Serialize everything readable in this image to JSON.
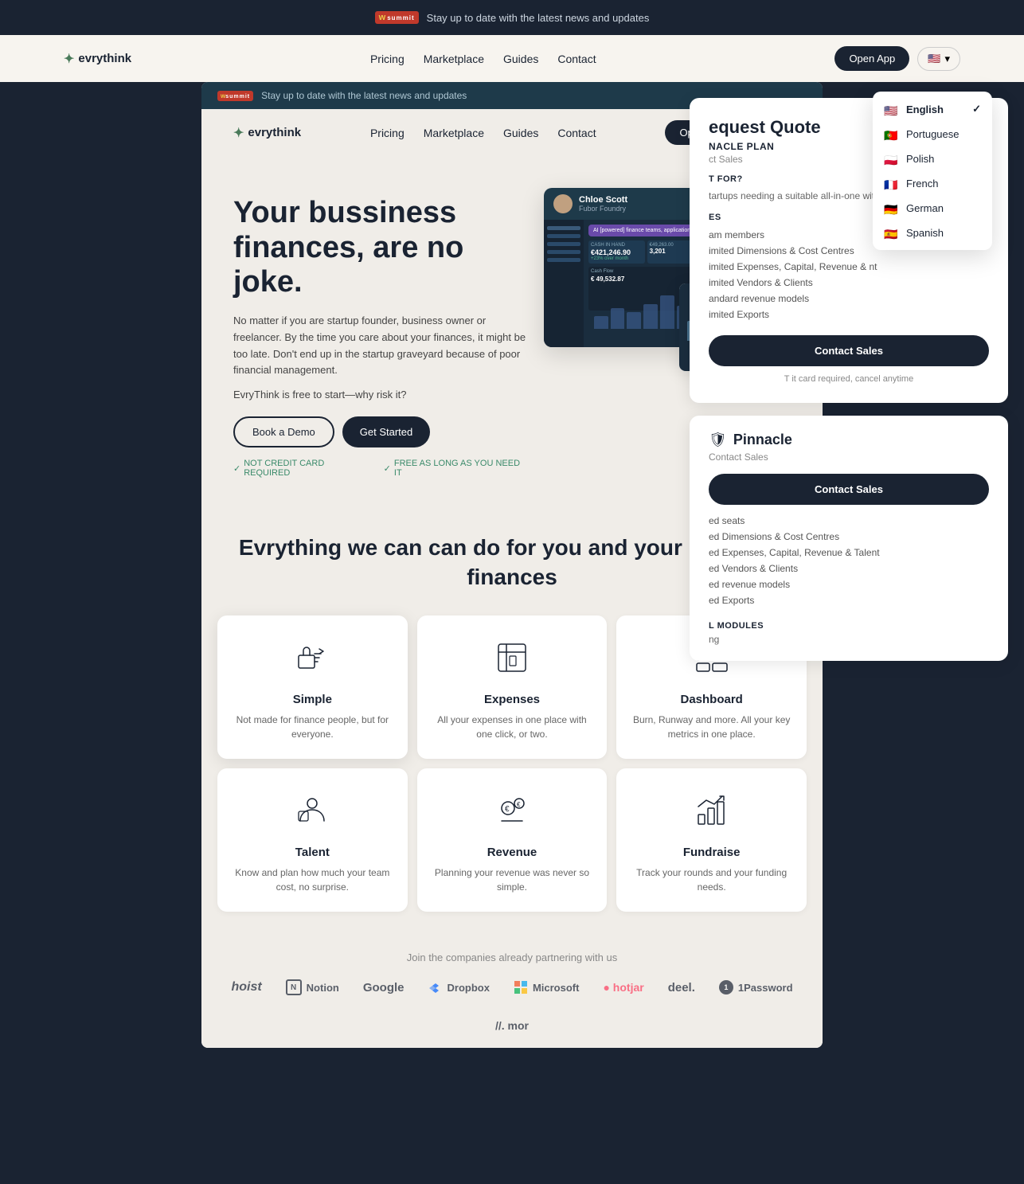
{
  "topBanner": {
    "text": "Stay up to date with the latest news and updates"
  },
  "nav": {
    "logo": "evrythink",
    "links": [
      "Pricing",
      "Marketplace",
      "Guides",
      "Contact"
    ],
    "openAppLabel": "Open App",
    "langCode": "🇺🇸"
  },
  "innerBanner": {
    "text": "Stay up to date with the latest news and updates"
  },
  "innerNav": {
    "logo": "evrythink",
    "links": [
      "Pricing",
      "Marketplace",
      "Guides",
      "Contact"
    ],
    "openAppLabel": "Open App"
  },
  "hero": {
    "title": "Your bussiness finances, are no joke.",
    "description": "No matter if you are startup founder, business owner or freelancer. By the time you care about your finances, it might be too late. Don't end up in the startup graveyard because of poor financial management.",
    "tagline": "EvryThink is free to start—why risk it?",
    "bookDemoLabel": "Book a Demo",
    "getStartedLabel": "Get Started",
    "note1": "NOT CREDIT CARD REQUIRED",
    "note2": "FREE AS LONG AS YOU NEED IT",
    "userAvatar": "Chloe Scott",
    "userRole": "Fubor Foundry",
    "cashLabel": "CASH IN HAND",
    "amount": "€421,246.90",
    "change": "+23% over month"
  },
  "sectionTitle": "Evrything we can can do for you and your business finances",
  "features": [
    {
      "name": "Simple",
      "desc": "Not made for finance people, but for everyone.",
      "icon": "👍"
    },
    {
      "name": "Expenses",
      "desc": "All your expenses in one place with one click, or two.",
      "icon": "📊"
    },
    {
      "name": "Dashboard",
      "desc": "Burn, Runway and more. All your key metrics in one place.",
      "icon": "📈"
    },
    {
      "name": "Talent",
      "desc": "Know and plan how much your team cost, no surprise.",
      "icon": "👥"
    },
    {
      "name": "Revenue",
      "desc": "Planning your revenue was never so simple.",
      "icon": "💰"
    },
    {
      "name": "Fundraise",
      "desc": "Track your rounds and your funding needs.",
      "icon": "🚀"
    }
  ],
  "partnersTitle": "Join the companies already partnering with us",
  "partners": [
    {
      "name": "hoist",
      "icon": "H"
    },
    {
      "name": "Notion",
      "icon": "N"
    },
    {
      "name": "Google",
      "icon": "G"
    },
    {
      "name": "Dropbox",
      "icon": "D"
    },
    {
      "name": "Microsoft",
      "icon": "M"
    },
    {
      "name": "hotjar",
      "icon": "h"
    },
    {
      "name": "deel.",
      "icon": "d"
    },
    {
      "name": "1Password",
      "icon": "1"
    },
    {
      "name": "mor",
      "icon": "m"
    }
  ],
  "rightPanel": {
    "quoteTitle": "equest Quote",
    "planLabel": "NACLE PLAN",
    "planSubLabel": "ct Sales",
    "forLabel": "T FOR?",
    "forDesc": "tartups needing a suitable all-in-one with advanced features",
    "featuresLabel": "ES",
    "features": [
      "am members",
      "imited Dimensions & Cost Centres",
      "imited Expenses, Capital, Revenue & nt",
      "imited Vendors & Clients",
      "andard revenue models",
      "imited Exports"
    ],
    "contactSalesLabel": "Contact Sales",
    "paymentNote": "T",
    "paymentDesc": "it card required, cancel anytime"
  },
  "pinnacleCard": {
    "name": "Pinnacle",
    "subtitle": "Contact Sales",
    "contactSalesLabel": "Contact Sales",
    "features": [
      "ed seats",
      "ed Dimensions & Cost Centres",
      "ed Expenses, Capital, Revenue & Talent",
      "ed Vendors & Clients",
      "ed revenue models",
      "ed Exports"
    ],
    "sectionLabel": "L MODULES",
    "sectionSub": "ng"
  },
  "langDropdown": {
    "options": [
      {
        "lang": "English",
        "flag": "🇺🇸",
        "selected": true
      },
      {
        "lang": "Portuguese",
        "flag": "🇵🇹",
        "selected": false
      },
      {
        "lang": "Polish",
        "flag": "🇵🇱",
        "selected": false
      },
      {
        "lang": "French",
        "flag": "🇫🇷",
        "selected": false
      },
      {
        "lang": "German",
        "flag": "🇩🇪",
        "selected": false
      },
      {
        "lang": "Spanish",
        "flag": "🇪🇸",
        "selected": false
      }
    ]
  }
}
